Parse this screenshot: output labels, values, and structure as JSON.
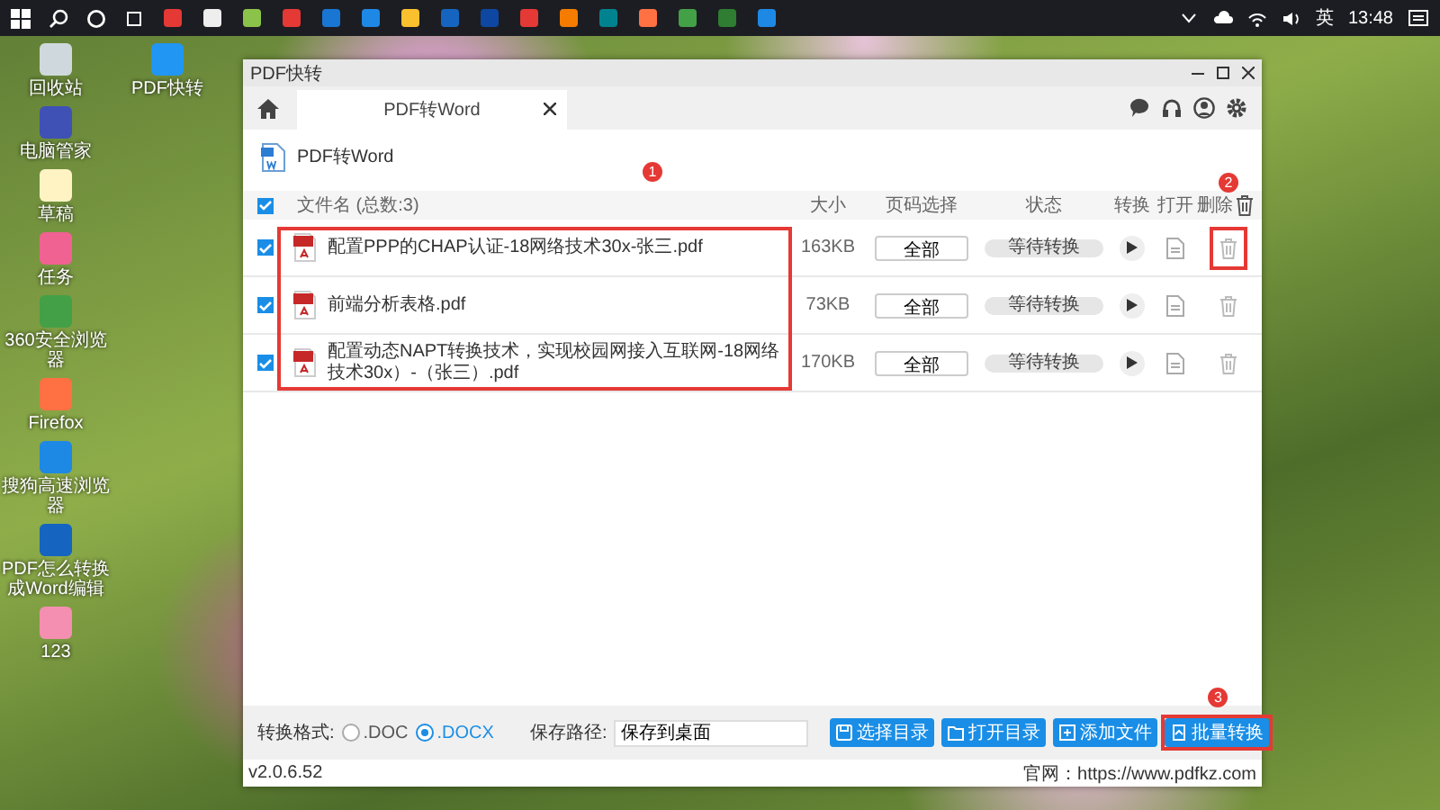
{
  "taskbar": {
    "ime": "英",
    "time": "13:48"
  },
  "desktop_icons": [
    {
      "label": "回收站"
    },
    {
      "label": "PDF快转"
    },
    {
      "label": "电脑管家"
    },
    {
      "label": "草稿"
    },
    {
      "label": "任务"
    },
    {
      "label": "360安全浏览器"
    },
    {
      "label": "Firefox"
    },
    {
      "label": "搜狗高速浏览器"
    },
    {
      "label": "PDF怎么转换成Word编辑"
    },
    {
      "label": "123"
    }
  ],
  "window": {
    "title": "PDF快转",
    "tabs": [
      {
        "label": "PDF转Word",
        "selected": true
      }
    ],
    "page_title": "PDF转Word",
    "table": {
      "all_checked": true,
      "columns": [
        "文件名 (总数:3)",
        "大小",
        "页码选择",
        "状态",
        "转换",
        "打开",
        "删除"
      ],
      "rows": [
        {
          "checked": true,
          "name": "配置PPP的CHAP认证-18网络技术30x-张三.pdf",
          "size": "163KB",
          "pages": "全部",
          "status": "等待转换"
        },
        {
          "checked": true,
          "name": "前端分析表格.pdf",
          "size": "73KB",
          "pages": "全部",
          "status": "等待转换"
        },
        {
          "checked": true,
          "name": "配置动态NAPT转换技术，实现校园网接入互联网-18网络技术30x）-（张三）.pdf",
          "size": "170KB",
          "pages": "全部",
          "status": "等待转换"
        }
      ]
    },
    "bottom": {
      "format_label": "转换格式:",
      "formats": [
        {
          "label": ".DOC",
          "selected": false
        },
        {
          "label": ".DOCX",
          "selected": true
        }
      ],
      "path_label": "保存路径:",
      "path_value": "保存到桌面",
      "buttons": [
        {
          "label": "选择目录",
          "kind": "save"
        },
        {
          "label": "打开目录",
          "kind": "folder"
        },
        {
          "label": "添加文件",
          "kind": "add"
        },
        {
          "label": "批量转换",
          "kind": "convert"
        }
      ]
    },
    "version": "v2.0.6.52",
    "website": "官网：https://www.pdfkz.com"
  },
  "annotations": [
    {
      "number": "1"
    },
    {
      "number": "2"
    },
    {
      "number": "3"
    }
  ]
}
